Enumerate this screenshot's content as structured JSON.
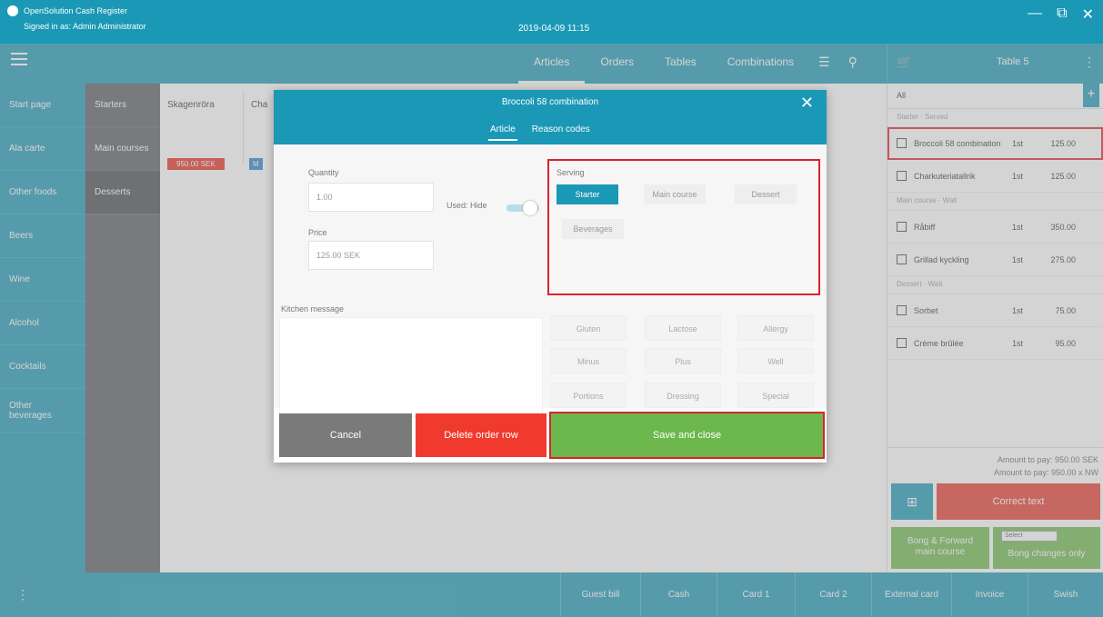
{
  "window": {
    "app_title": "OpenSolution Cash Register",
    "signed_in": "Signed in as: Admin Administrator",
    "datetime": "2019-04-09 11:15",
    "controls": [
      "—",
      "⧉",
      "✕"
    ]
  },
  "topnav": {
    "links": [
      "Articles",
      "Orders",
      "Tables",
      "Combinations"
    ],
    "active": "Articles",
    "table_label": "Table 5"
  },
  "categories": [
    "Start page",
    "Ala carte",
    "Other foods",
    "Beers",
    "Wine",
    "Alcohol",
    "Cocktails",
    "Other beverages"
  ],
  "subcategories": [
    "Starters",
    "Main courses",
    "Desserts"
  ],
  "main": {
    "tiles": [
      "Skagenröra",
      "Cha"
    ],
    "red_badge": "950.00 SEK",
    "blue_badge": "M"
  },
  "order": {
    "tab_all": "All",
    "groups": [
      {
        "label": "Starter · Served",
        "items": [
          {
            "name": "Broccoli 58 combination",
            "qty": "1st",
            "price": "125.00",
            "highlight": true
          },
          {
            "name": "Charkuteriatallrik",
            "qty": "1st",
            "price": "125.00",
            "highlight": false
          }
        ]
      },
      {
        "label": "Main course · Wait",
        "items": [
          {
            "name": "Råbiff",
            "qty": "1st",
            "price": "350.00",
            "highlight": false
          },
          {
            "name": "Grillad kyckling",
            "qty": "1st",
            "price": "275.00",
            "highlight": false
          }
        ]
      },
      {
        "label": "Dessert · Wait",
        "items": [
          {
            "name": "Sorbet",
            "qty": "1st",
            "price": "75.00",
            "highlight": false
          },
          {
            "name": "Crème brûlée",
            "qty": "1st",
            "price": "95.00",
            "highlight": false
          }
        ]
      }
    ],
    "amount_pay": "Amount to pay: 950.00 SEK",
    "amount_pay2": "Amount to pay: 950.00 x NW",
    "correct_label": "Correct text",
    "bong_forward": "Bong & Forward\nmain course",
    "bong_changes": "Bong changes only",
    "select_placeholder": "Select"
  },
  "bottom": [
    "Guest bill",
    "Cash",
    "Card 1",
    "Card 2",
    "External card",
    "Invoice",
    "Swish"
  ],
  "dialog": {
    "title": "Broccoli 58 combination",
    "tabs": [
      "Article",
      "Reason codes"
    ],
    "active_tab": "Article",
    "quantity_label": "Quantity",
    "quantity_value": "1.00",
    "used_label": "Used: Hide",
    "price_label": "Price",
    "price_value": "125.00 SEK",
    "message_label": "Kitchen message",
    "serving_label": "Serving",
    "serving_options": [
      "Starter",
      "Main course",
      "Dessert",
      "Beverages"
    ],
    "serving_selected": "Starter",
    "modifiers": [
      "Gluten",
      "Lactose",
      "Allergy",
      "Minus",
      "Plus",
      "Well",
      "Portions",
      "Dressing",
      "Special"
    ],
    "cancel_label": "Cancel",
    "delete_label": "Delete order row",
    "save_label": "Save and close"
  }
}
